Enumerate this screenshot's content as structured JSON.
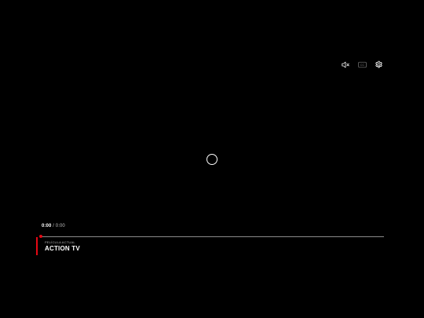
{
  "player": {
    "top_controls": [
      {
        "icon": "volume-muted-icon",
        "label": "Mute"
      },
      {
        "icon": "captions-icon",
        "label": "CC"
      },
      {
        "icon": "gear-icon",
        "label": "Settings"
      }
    ],
    "captions_text": "CC",
    "time": {
      "current": "0:00",
      "separator": "/",
      "duration": "0:00"
    },
    "progress": 0,
    "now_playing": {
      "label": "PELÍCULA ACTUAL",
      "title": "ACTION TV"
    }
  },
  "colors": {
    "background": "#000000",
    "accent": "#e50914",
    "text": "#ffffff",
    "muted_text": "#b3b3b3"
  }
}
